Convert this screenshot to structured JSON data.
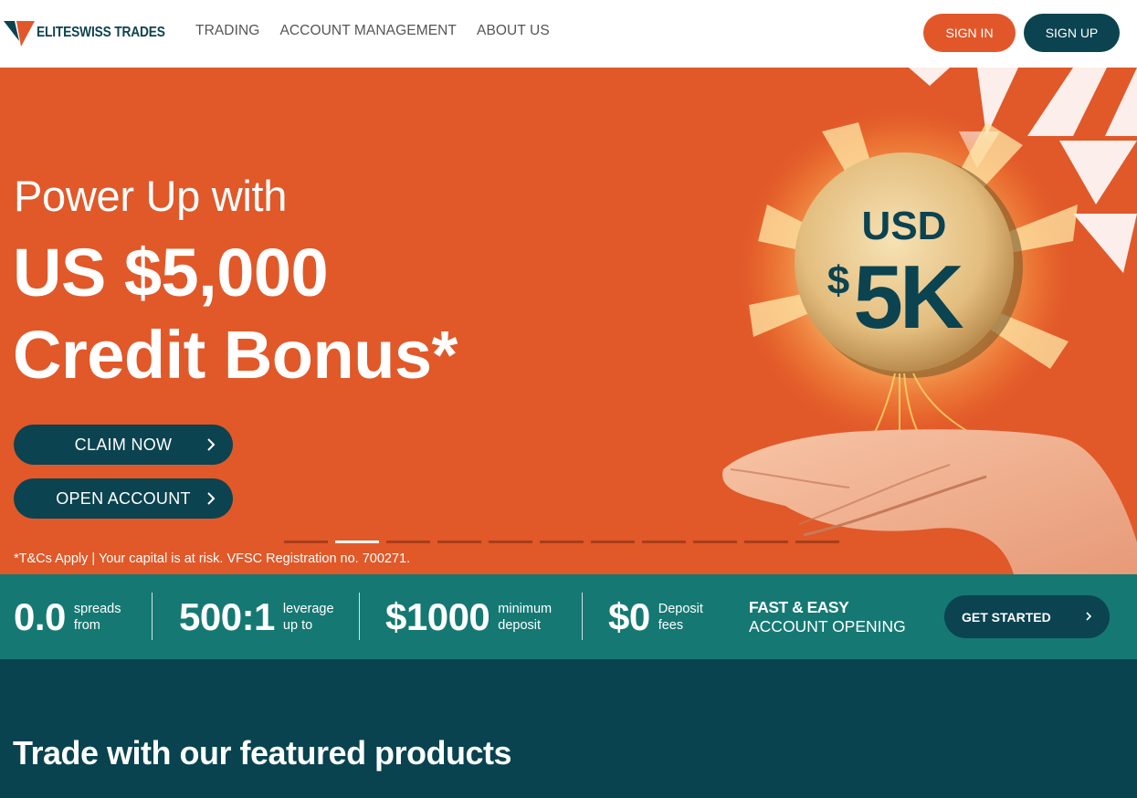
{
  "brand": {
    "name": "ELITESWISS TRADES"
  },
  "nav": {
    "items": [
      "TRADING",
      "ACCOUNT MANAGEMENT",
      "ABOUT US"
    ]
  },
  "auth": {
    "signin": "SIGN IN",
    "signup": "SIGN UP"
  },
  "hero": {
    "pre": "Power Up with",
    "amount": "US $5,000",
    "bonus": "Credit Bonus*",
    "claim": "CLAIM NOW",
    "open": "OPEN ACCOUNT",
    "disclaimer": "*T&Cs Apply | Your capital is at risk. VFSC Registration no. 700271.",
    "coin_top": "USD",
    "coin_dollar": "$",
    "coin_value": "5K",
    "carousel": {
      "slides": 11,
      "active_index": 1
    }
  },
  "stats": {
    "items": [
      {
        "big": "0.0",
        "line1": "spreads",
        "line2": "from"
      },
      {
        "big": "500:1",
        "line1": "leverage",
        "line2": "up to"
      },
      {
        "big": "$1000",
        "line1": "minimum",
        "line2": "deposit"
      },
      {
        "big": "$0",
        "line1": "Deposit",
        "line2": "fees"
      }
    ],
    "fast_line1": "FAST & EASY",
    "fast_line2": "ACCOUNT OPENING",
    "cta": "GET STARTED"
  },
  "featured": {
    "title": "Trade with our featured products"
  },
  "colors": {
    "orange": "#e15829",
    "navy": "#0b4350",
    "teal": "#157873",
    "dark_teal": "#08434f"
  },
  "icons": [
    "logo-v-icon",
    "chevron-right-icon"
  ]
}
